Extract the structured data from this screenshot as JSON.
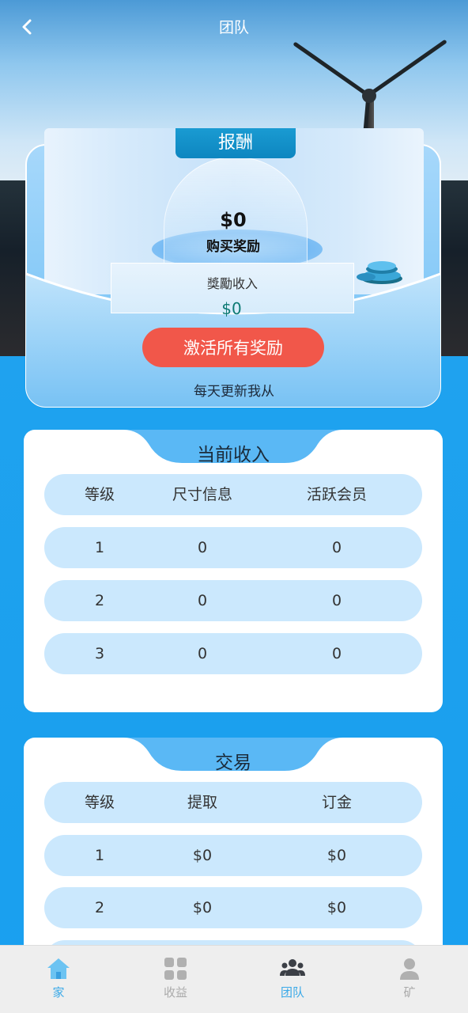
{
  "header": {
    "title": "团队"
  },
  "reward": {
    "tab_label": "报酬",
    "amount": "$0",
    "amount_label": "购买奖励",
    "income_label": "獎勵收入",
    "income_value": "$0",
    "activate_button": "激活所有奖励",
    "daily_note": "每天更新我从"
  },
  "current_income": {
    "title": "当前收入",
    "headers": [
      "等级",
      "尺寸信息",
      "活跃会员"
    ],
    "rows": [
      [
        "1",
        "0",
        "0"
      ],
      [
        "2",
        "0",
        "0"
      ],
      [
        "3",
        "0",
        "0"
      ]
    ]
  },
  "trade": {
    "title": "交易",
    "headers": [
      "等级",
      "提取",
      "订金"
    ],
    "rows": [
      [
        "1",
        "$0",
        "$0"
      ],
      [
        "2",
        "$0",
        "$0"
      ]
    ]
  },
  "nav": {
    "items": [
      {
        "label": "家",
        "icon": "home-icon",
        "color": "#3aa9e8"
      },
      {
        "label": "收益",
        "icon": "grid-icon",
        "color": "#aaaaaa"
      },
      {
        "label": "团队",
        "icon": "team-icon",
        "color": "#3aa9e8"
      },
      {
        "label": "矿",
        "icon": "user-icon",
        "color": "#aaaaaa"
      }
    ]
  },
  "colors": {
    "primary": "#1ba0ee",
    "accent_button": "#f1574a",
    "row_bg": "#cbe8fd"
  }
}
